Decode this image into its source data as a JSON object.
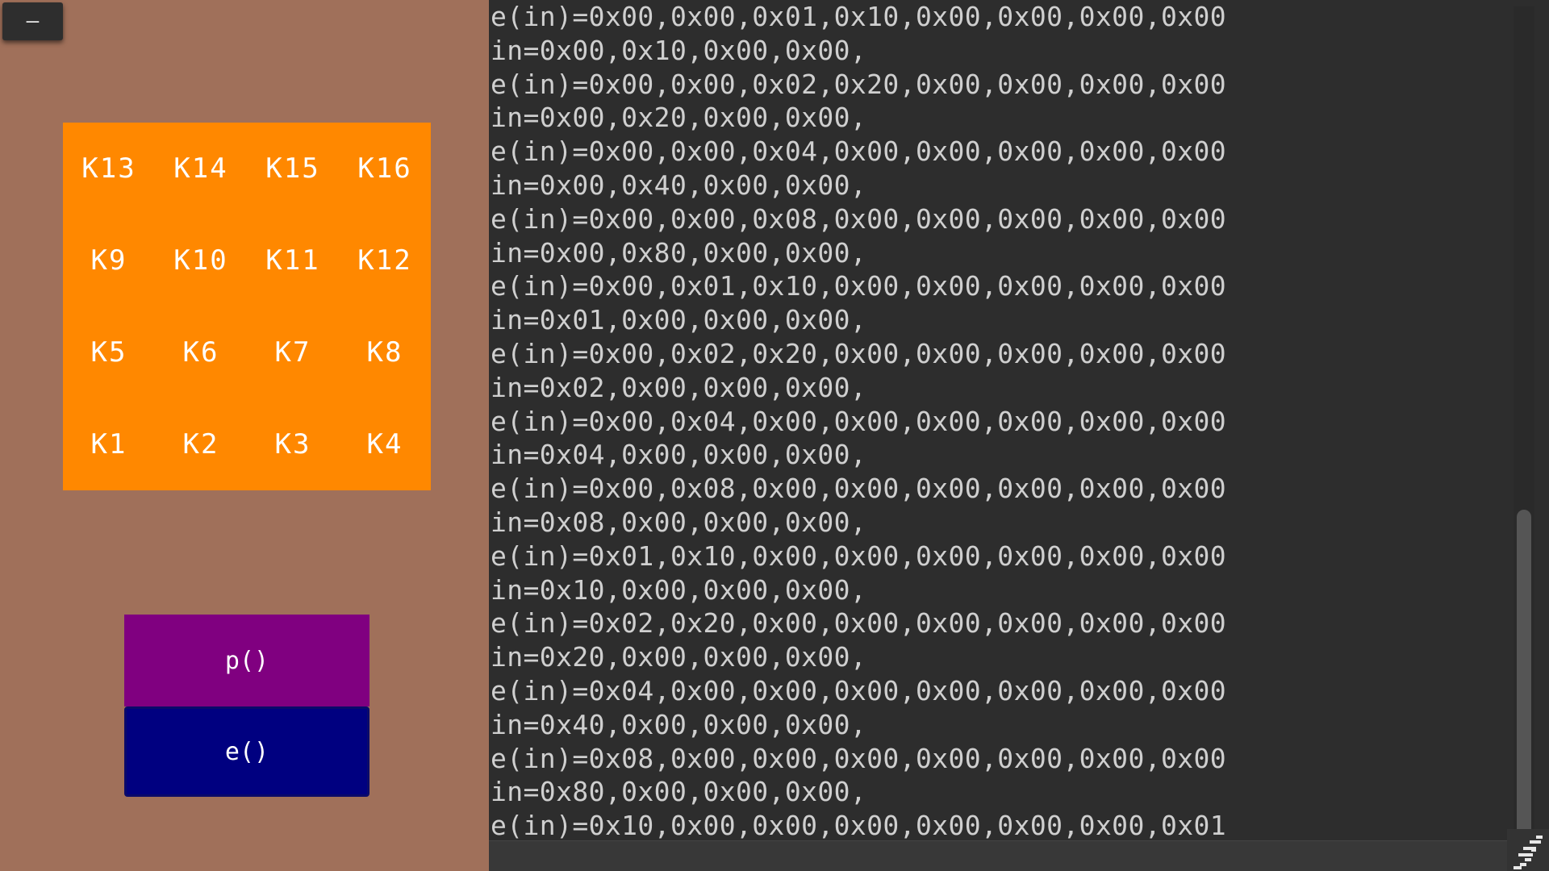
{
  "window": {
    "minimize_label": "–"
  },
  "keypad": {
    "keys": [
      "K13",
      "K14",
      "K15",
      "K16",
      "K9",
      "K10",
      "K11",
      "K12",
      "K5",
      "K6",
      "K7",
      "K8",
      "K1",
      "K2",
      "K3",
      "K4"
    ]
  },
  "controls": {
    "p_label": "p()",
    "e_label": "e()"
  },
  "console": {
    "lines": [
      "e(in)=0x00,0x00,0x01,0x10,0x00,0x00,0x00,0x00",
      "in=0x00,0x10,0x00,0x00,",
      "e(in)=0x00,0x00,0x02,0x20,0x00,0x00,0x00,0x00",
      "in=0x00,0x20,0x00,0x00,",
      "e(in)=0x00,0x00,0x04,0x00,0x00,0x00,0x00,0x00",
      "in=0x00,0x40,0x00,0x00,",
      "e(in)=0x00,0x00,0x08,0x00,0x00,0x00,0x00,0x00",
      "in=0x00,0x80,0x00,0x00,",
      "e(in)=0x00,0x01,0x10,0x00,0x00,0x00,0x00,0x00",
      "in=0x01,0x00,0x00,0x00,",
      "e(in)=0x00,0x02,0x20,0x00,0x00,0x00,0x00,0x00",
      "in=0x02,0x00,0x00,0x00,",
      "e(in)=0x00,0x04,0x00,0x00,0x00,0x00,0x00,0x00",
      "in=0x04,0x00,0x00,0x00,",
      "e(in)=0x00,0x08,0x00,0x00,0x00,0x00,0x00,0x00",
      "in=0x08,0x00,0x00,0x00,",
      "e(in)=0x01,0x10,0x00,0x00,0x00,0x00,0x00,0x00",
      "in=0x10,0x00,0x00,0x00,",
      "e(in)=0x02,0x20,0x00,0x00,0x00,0x00,0x00,0x00",
      "in=0x20,0x00,0x00,0x00,",
      "e(in)=0x04,0x00,0x00,0x00,0x00,0x00,0x00,0x00",
      "in=0x40,0x00,0x00,0x00,",
      "e(in)=0x08,0x00,0x00,0x00,0x00,0x00,0x00,0x00",
      "in=0x80,0x00,0x00,0x00,",
      "e(in)=0x10,0x00,0x00,0x00,0x00,0x00,0x00,0x01"
    ],
    "scroll_position": 1.0
  },
  "colors": {
    "background": "#a0705a",
    "keypad": "#ff8800",
    "p_button": "#800080",
    "e_button": "#000080",
    "console_bg": "#2d2d2d",
    "console_text": "#cfcfcf"
  },
  "icons": {
    "resize_grip": "resize-grip-icon"
  }
}
